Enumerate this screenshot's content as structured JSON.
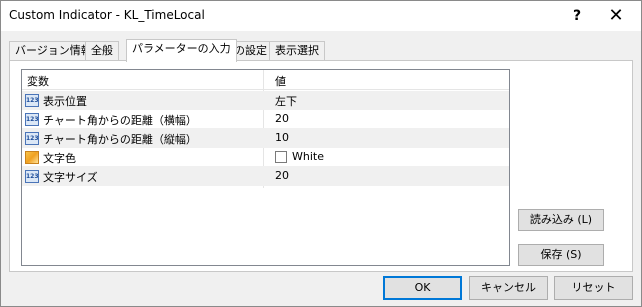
{
  "window": {
    "title": "Custom Indicator - KL_TimeLocal",
    "help_glyph": "?",
    "close_glyph": "✕"
  },
  "tabs": [
    {
      "label": "バージョン情報"
    },
    {
      "label": "全般"
    },
    {
      "label": "パラメーターの入力"
    },
    {
      "label": "色の設定"
    },
    {
      "label": "表示選択"
    }
  ],
  "active_tab": "パラメーターの入力",
  "grid": {
    "headers": {
      "variable": "変数",
      "value": "値"
    },
    "rows": [
      {
        "icon": "number-param-icon",
        "icon_text": "123",
        "name": "表示位置",
        "value": "左下"
      },
      {
        "icon": "number-param-icon",
        "icon_text": "123",
        "name": "チャート角からの距離（横幅）",
        "value": "20"
      },
      {
        "icon": "number-param-icon",
        "icon_text": "123",
        "name": "チャート角からの距離（縦幅）",
        "value": "10"
      },
      {
        "icon": "color-param-icon",
        "icon_text": "",
        "name": "文字色",
        "value": "White",
        "swatch_color": "#ffffff"
      },
      {
        "icon": "number-param-icon",
        "icon_text": "123",
        "name": "文字サイズ",
        "value": "20"
      }
    ]
  },
  "side_buttons": {
    "load": "読み込み (L)",
    "save": "保存 (S)"
  },
  "footer_buttons": {
    "ok": "OK",
    "cancel": "キャンセル",
    "reset": "リセット"
  },
  "colors": {
    "default_button_border": "#0078d7",
    "icon_border": "#4a74b8",
    "color_icon": "#f0a020"
  }
}
